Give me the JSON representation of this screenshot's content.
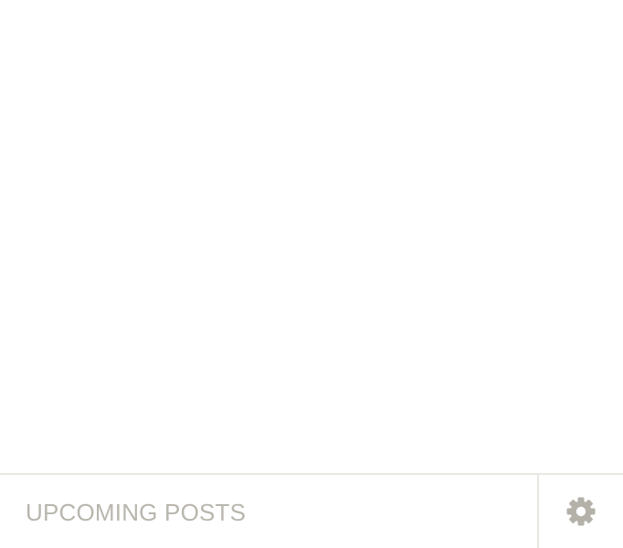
{
  "footer": {
    "section_title": "UPCOMING POSTS",
    "settings_icon": "gear-icon"
  },
  "colors": {
    "background": "#ffffff",
    "border": "#e8e7e2",
    "title_text": "#b8b6ad",
    "icon": "#b3b1a8"
  }
}
